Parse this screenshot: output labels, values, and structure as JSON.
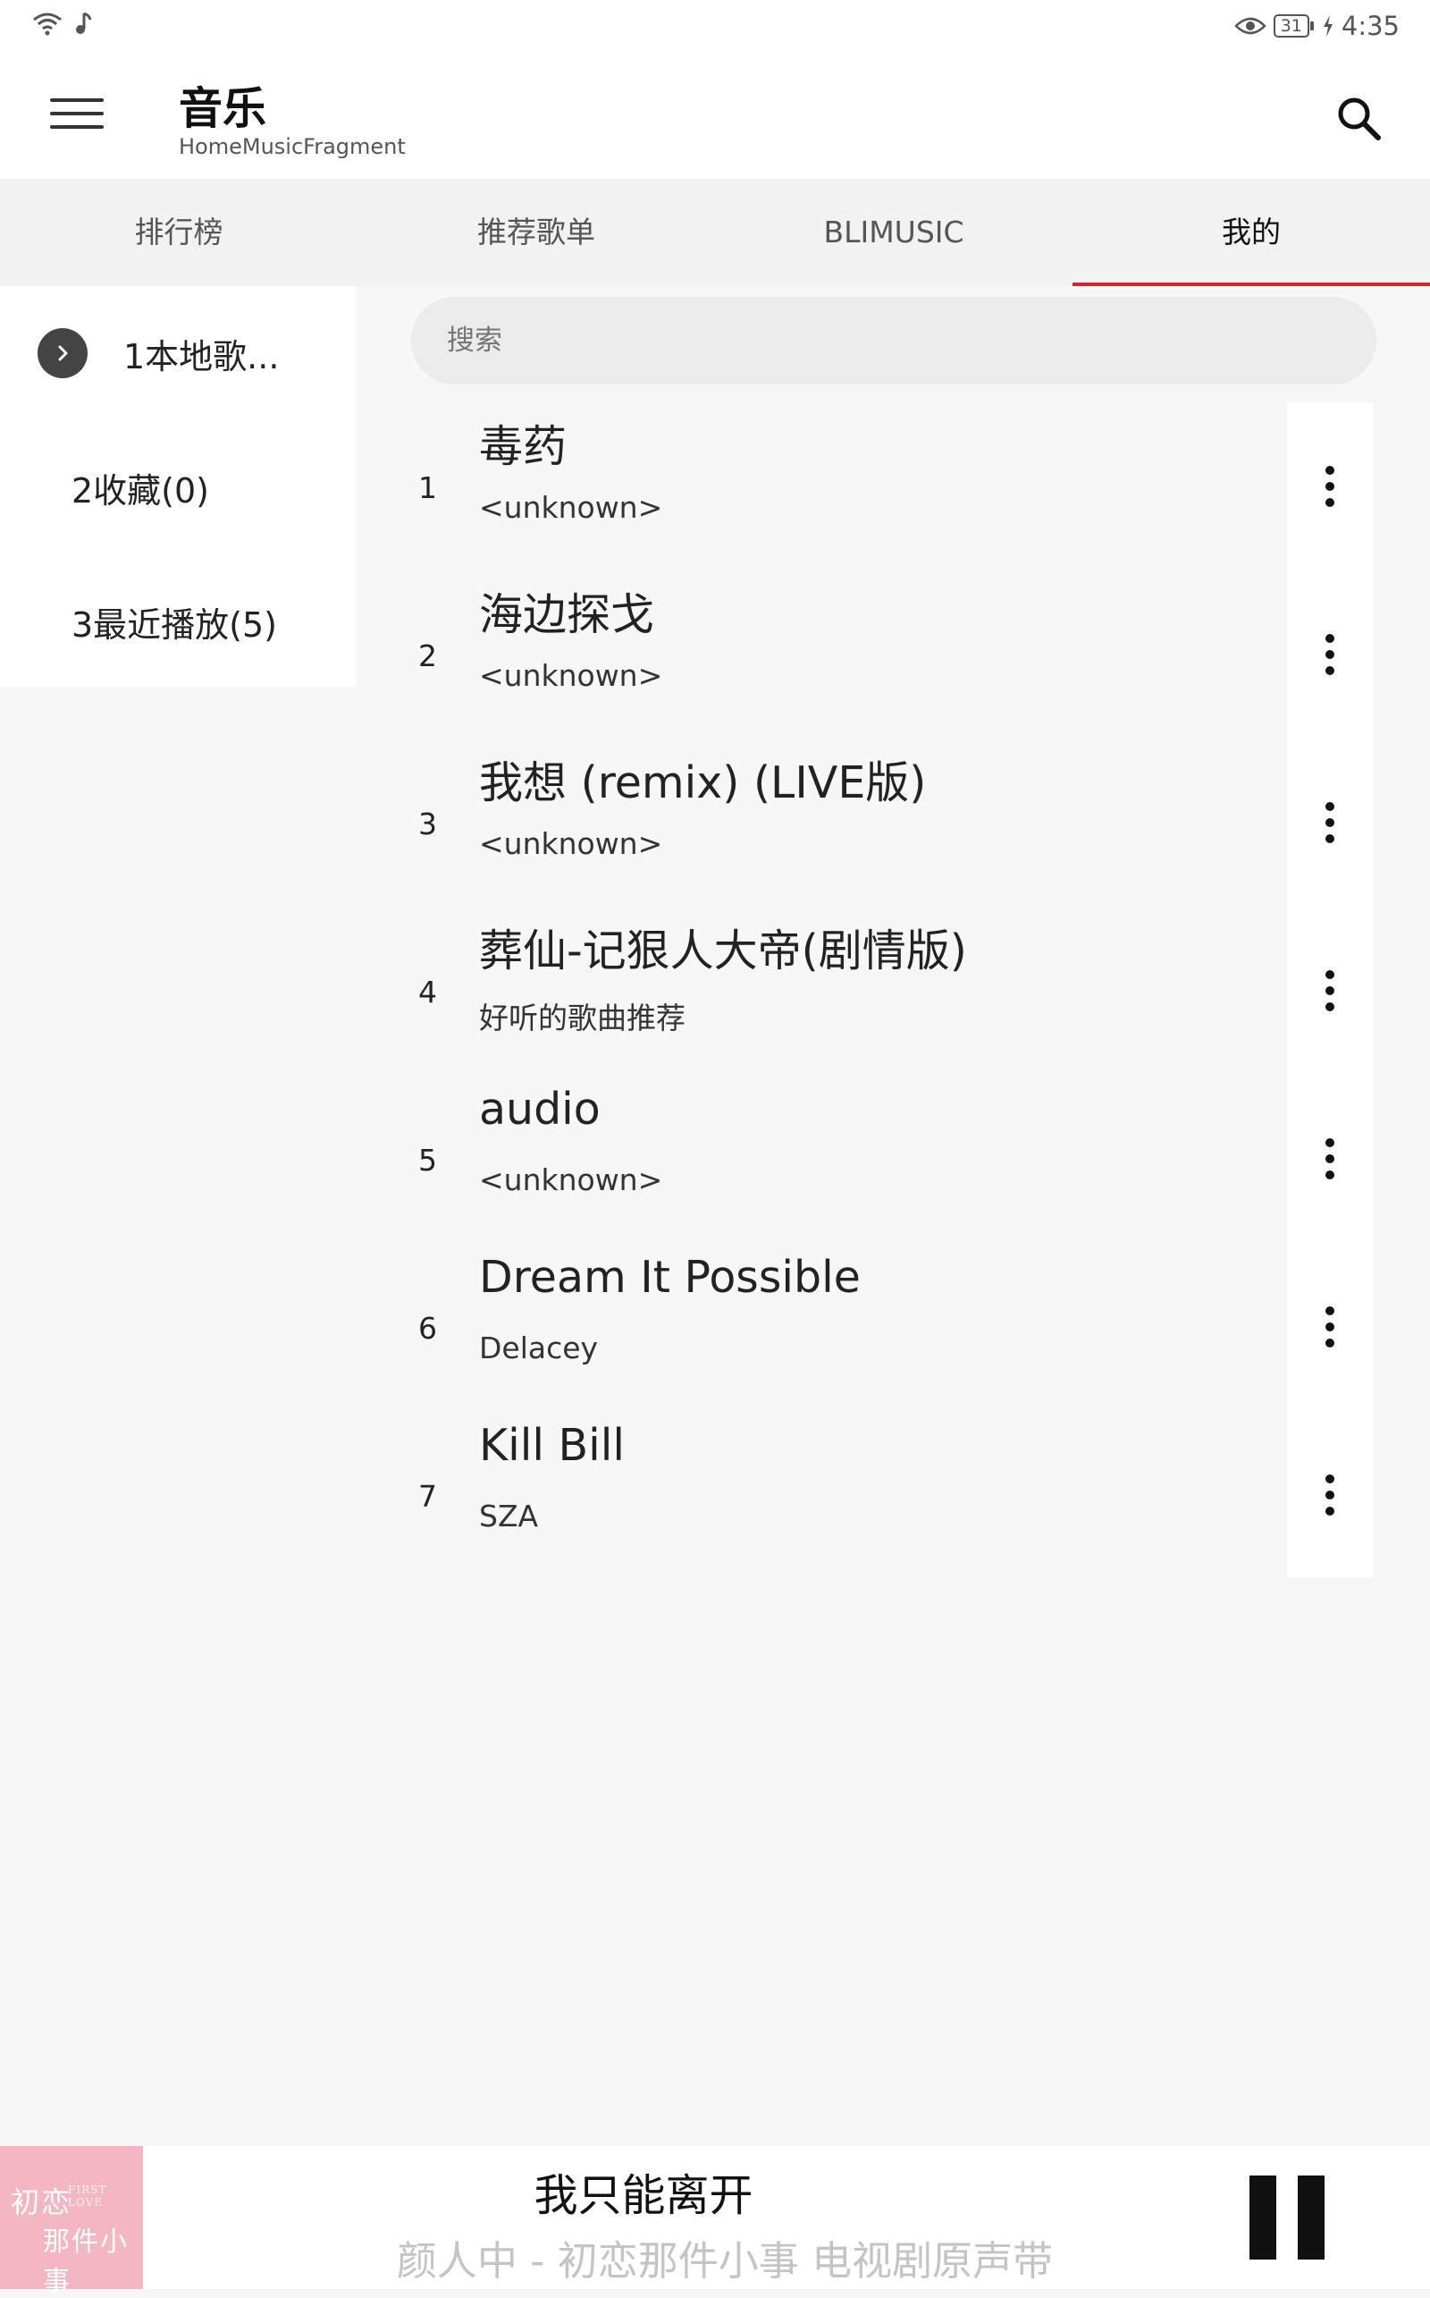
{
  "status_bar": {
    "time": "4:35",
    "battery": "31"
  },
  "header": {
    "title": "音乐",
    "subtitle": "HomeMusicFragment"
  },
  "tabs": [
    {
      "label": "排行榜",
      "active": false
    },
    {
      "label": "推荐歌单",
      "active": false
    },
    {
      "label": "BLIMUSIC",
      "active": false
    },
    {
      "label": "我的",
      "active": true
    }
  ],
  "sidebar": {
    "items": [
      {
        "label": "1本地歌..."
      },
      {
        "label": "2收藏(0)"
      },
      {
        "label": "3最近播放(5)"
      }
    ]
  },
  "search": {
    "placeholder": "搜索"
  },
  "songs": [
    {
      "index": "1",
      "title": "毒药",
      "artist": "<unknown>"
    },
    {
      "index": "2",
      "title": "海边探戈",
      "artist": "<unknown>"
    },
    {
      "index": "3",
      "title": "我想 (remix) (LIVE版)",
      "artist": "<unknown>"
    },
    {
      "index": "4",
      "title": "葬仙-记狠人大帝(剧情版)",
      "artist": "好听的歌曲推荐"
    },
    {
      "index": "5",
      "title": "audio",
      "artist": "<unknown>"
    },
    {
      "index": "6",
      "title": "Dream It Possible",
      "artist": "Delacey"
    },
    {
      "index": "7",
      "title": "Kill Bill",
      "artist": "SZA"
    }
  ],
  "player": {
    "title": "我只能离开",
    "subtitle": "颜人中 - 初恋那件小事 电视剧原声带",
    "cover_art": {
      "line1": "初恋",
      "line2": "那件小事",
      "small_text": "FIRST LOVE"
    }
  },
  "colors": {
    "accent": "#d0262d",
    "cover": "#f4b6c2"
  },
  "icons": [
    "wifi-icon",
    "music-note-icon",
    "eye-icon",
    "battery-icon",
    "charging-icon",
    "menu-icon",
    "search-icon",
    "chevron-right-icon",
    "more-vert-icon",
    "pause-icon"
  ]
}
